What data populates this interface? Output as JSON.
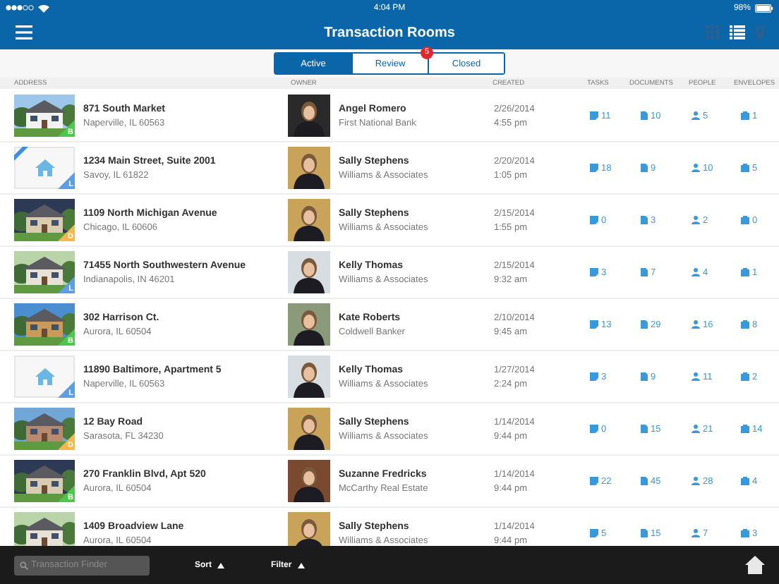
{
  "status_bar": {
    "time": "4:04 PM",
    "battery": "98%"
  },
  "nav": {
    "title": "Transaction Rooms",
    "views": [
      {
        "kind": "grid",
        "selected": false
      },
      {
        "kind": "list",
        "selected": true
      },
      {
        "kind": "map",
        "selected": false
      }
    ]
  },
  "segments": [
    {
      "label": "Active",
      "selected": true
    },
    {
      "label": "Review",
      "selected": false,
      "badge": "5"
    },
    {
      "label": "Closed",
      "selected": false
    }
  ],
  "columns": [
    "ADDRESS",
    "OWNER",
    "CREATED",
    "TASKS",
    "DOCUMENTS",
    "PEOPLE",
    "ENVELOPES"
  ],
  "rows": [
    {
      "address": "871 South Market",
      "city": "Naperville, IL 60563",
      "kind": "picture",
      "new_ribbon": false,
      "badge": {
        "letter": "B",
        "color": "#4cc94c"
      },
      "owner": "Angel Romero",
      "company": "First National Bank",
      "date": "2/26/2014",
      "time": "4:55 pm",
      "tasks": "11",
      "documents": "10",
      "people": "5",
      "envelopes": "1"
    },
    {
      "address": "1234 Main Street, Suite 2001",
      "city": "Savoy, IL 61822",
      "kind": "placeholder",
      "new_ribbon": true,
      "badge": {
        "letter": "L",
        "color": "#5b9ee6"
      },
      "owner": "Sally Stephens",
      "company": "Williams & Associates",
      "date": "2/20/2014",
      "time": "1:05 pm",
      "tasks": "18",
      "documents": "9",
      "people": "10",
      "envelopes": "5"
    },
    {
      "address": "1109 North Michigan Avenue",
      "city": "Chicago, IL 60606",
      "kind": "picture",
      "new_ribbon": false,
      "badge": {
        "letter": "D",
        "color": "#f5b84a"
      },
      "owner": "Sally Stephens",
      "company": "Williams & Associates",
      "date": "2/15/2014",
      "time": "1:55 pm",
      "tasks": "0",
      "documents": "3",
      "people": "2",
      "envelopes": "0"
    },
    {
      "address": "71455 North Southwestern Avenue",
      "city": "Indianapolis, IN 46201",
      "kind": "picture",
      "new_ribbon": false,
      "badge": {
        "letter": "L",
        "color": "#5b9ee6"
      },
      "owner": "Kelly Thomas",
      "company": "Williams & Associates",
      "date": "2/15/2014",
      "time": "9:32 am",
      "tasks": "3",
      "documents": "7",
      "people": "4",
      "envelopes": "1"
    },
    {
      "address": "302 Harrison Ct.",
      "city": "Aurora, IL 60504",
      "kind": "picture",
      "new_ribbon": false,
      "badge": {
        "letter": "B",
        "color": "#4cc94c"
      },
      "owner": "Kate Roberts",
      "company": "Coldwell Banker",
      "date": "2/10/2014",
      "time": "9:45 am",
      "tasks": "13",
      "documents": "29",
      "people": "16",
      "envelopes": "8"
    },
    {
      "address": "11890 Baltimore, Apartment 5",
      "city": "Naperville, IL 60563",
      "kind": "placeholder",
      "new_ribbon": false,
      "badge": {
        "letter": "L",
        "color": "#5b9ee6"
      },
      "owner": "Kelly Thomas",
      "company": "Williams & Associates",
      "date": "1/27/2014",
      "time": "2:24 pm",
      "tasks": "3",
      "documents": "9",
      "people": "11",
      "envelopes": "2"
    },
    {
      "address": "12 Bay Road",
      "city": "Sarasota, FL 34230",
      "kind": "picture",
      "new_ribbon": false,
      "badge": {
        "letter": "D",
        "color": "#f5b84a"
      },
      "owner": "Sally Stephens",
      "company": "Williams & Associates",
      "date": "1/14/2014",
      "time": "9:44 pm",
      "tasks": "0",
      "documents": "15",
      "people": "21",
      "envelopes": "14"
    },
    {
      "address": "270 Franklin Blvd, Apt 520",
      "city": "Aurora, IL 60504",
      "kind": "picture",
      "new_ribbon": false,
      "badge": {
        "letter": "B",
        "color": "#4cc94c"
      },
      "owner": "Suzanne Fredricks",
      "company": "McCarthy Real Estate",
      "date": "1/14/2014",
      "time": "9:44 pm",
      "tasks": "22",
      "documents": "45",
      "people": "28",
      "envelopes": "4"
    },
    {
      "address": "1409 Broadview Lane",
      "city": "Aurora, IL 60504",
      "kind": "picture",
      "new_ribbon": false,
      "owner": "Sally Stephens",
      "company": "Williams & Associates",
      "date": "1/14/2014",
      "time": "9:44 pm",
      "tasks": "5",
      "documents": "15",
      "people": "7",
      "envelopes": "3"
    }
  ],
  "bottom_bar": {
    "search_placeholder": "Transaction Finder",
    "sort": "Sort",
    "filter": "Filter"
  }
}
